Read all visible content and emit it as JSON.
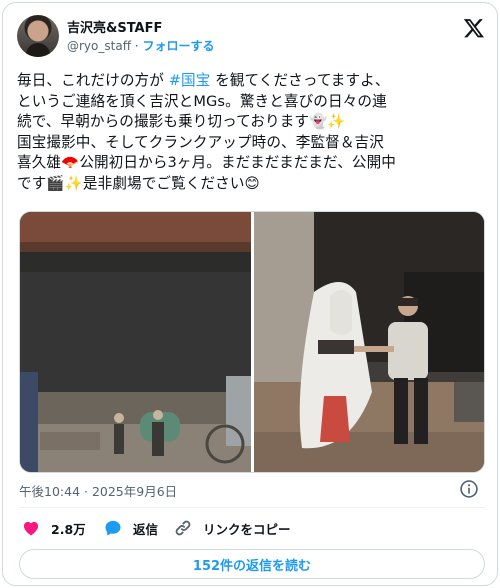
{
  "author": {
    "name": "吉沢亮&STAFF",
    "handle": "@ryo_staff",
    "separator": "·",
    "follow_label": "フォローする"
  },
  "tweet": {
    "line1a": "毎日、これだけの方が ",
    "hashtag": "#国宝",
    "line1b": " を観てくださってますよ、",
    "line2": "というご連絡を頂く吉沢とMGs。驚きと喜びの日々の連",
    "line3": "続で、早朝からの撮影も乗り切っております👻✨",
    "line4": "国宝撮影中、そしてクランクアップ時の、李監督＆吉沢",
    "line5": "喜久雄🪭公開初日から3ヶ月。まだまだまだまだ、公開中",
    "line6": "です🎬✨是非劇場でご覧ください😊"
  },
  "timestamp": "午後10:44 · 2025年9月6日",
  "actions": {
    "likes": "2.8万",
    "reply_label": "返信",
    "copy_link_label": "リンクをコピー"
  },
  "read_replies_label": "152件の返信を読む",
  "colors": {
    "accent": "#1d9bf0",
    "like": "#f91880",
    "muted": "#536471",
    "text": "#0f1419"
  },
  "icons": [
    "x-logo-icon",
    "info-icon",
    "heart-icon",
    "reply-bubble-icon",
    "link-icon"
  ]
}
